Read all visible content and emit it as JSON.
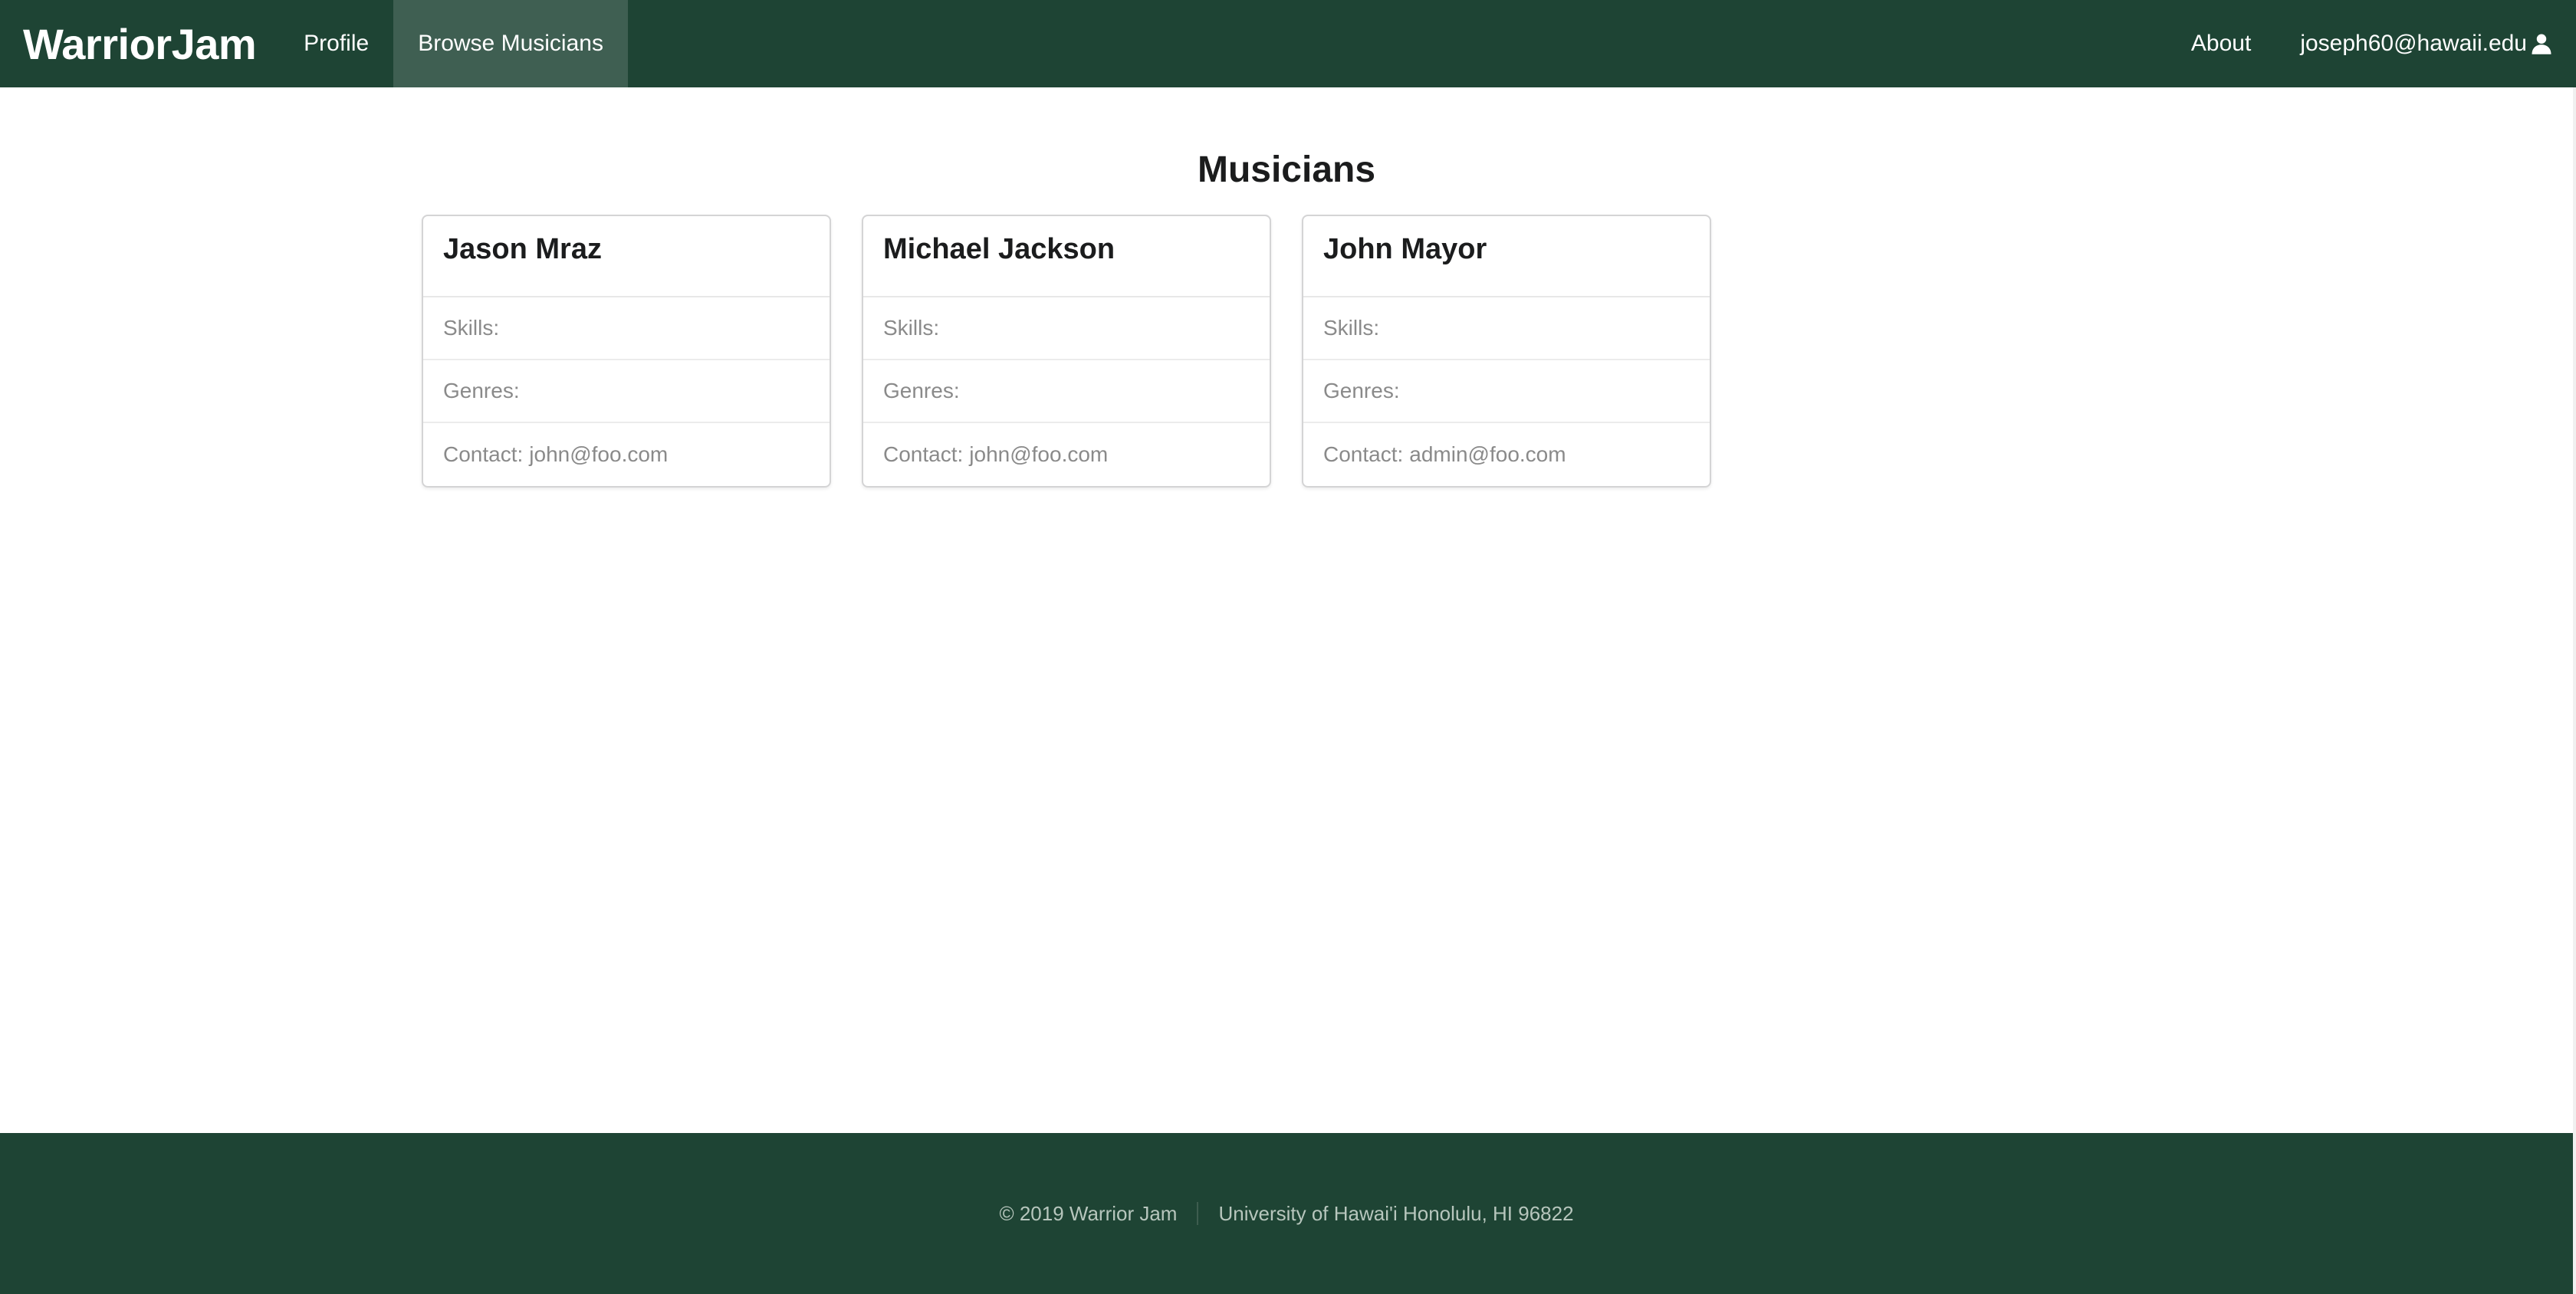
{
  "navbar": {
    "brand": "WarriorJam",
    "items": [
      {
        "label": "Profile",
        "active": false
      },
      {
        "label": "Browse Musicians",
        "active": true
      }
    ],
    "about_label": "About",
    "user_email": "joseph60@hawaii.edu",
    "user_icon": "user-icon"
  },
  "main": {
    "title": "Musicians",
    "cards": [
      {
        "name": "Jason Mraz",
        "skills_label": "Skills:",
        "skills": "",
        "genres_label": "Genres:",
        "genres": "",
        "contact_label": "Contact:",
        "contact": "john@foo.com"
      },
      {
        "name": "Michael Jackson",
        "skills_label": "Skills:",
        "skills": "",
        "genres_label": "Genres:",
        "genres": "",
        "contact_label": "Contact:",
        "contact": "john@foo.com"
      },
      {
        "name": "John Mayor",
        "skills_label": "Skills:",
        "skills": "",
        "genres_label": "Genres:",
        "genres": "",
        "contact_label": "Contact:",
        "contact": "admin@foo.com"
      }
    ]
  },
  "footer": {
    "copyright": "© 2019 Warrior Jam",
    "address": "University of Hawai'i Honolulu, HI 96822"
  },
  "colors": {
    "brand_green": "#1e4434",
    "text_muted": "#8a8a8a"
  }
}
